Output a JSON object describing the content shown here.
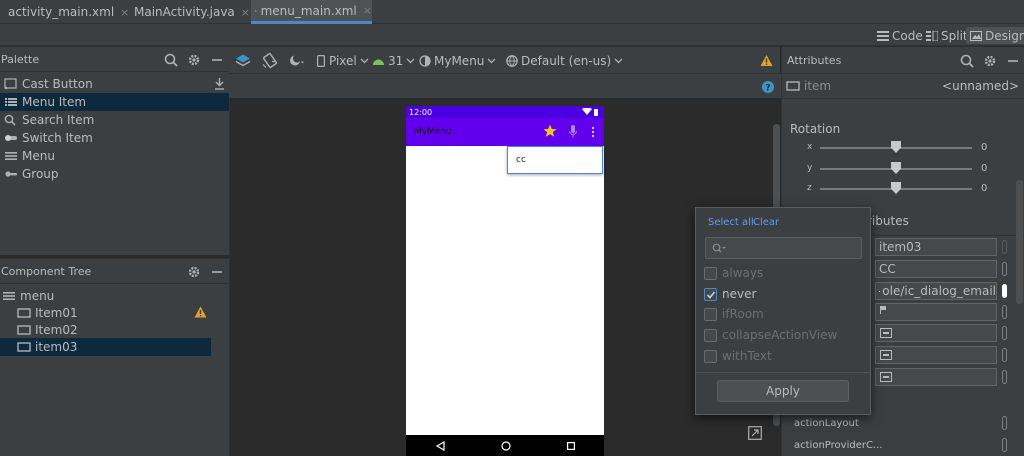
{
  "tabs": [
    {
      "label": "activity_main.xml",
      "close": "×"
    },
    {
      "label": "MainActivity.java",
      "close": "×"
    },
    {
      "label": "menu_main.xml",
      "close": "×"
    }
  ],
  "modes": {
    "code": "Code",
    "split": "Split",
    "design": "Design"
  },
  "palette": {
    "title": "Palette",
    "items": [
      "Cast Button",
      "Menu Item",
      "Search Item",
      "Switch Item",
      "Menu",
      "Group"
    ]
  },
  "component_tree": {
    "title": "Component Tree",
    "root": "menu",
    "items": [
      "Item01",
      "Item02",
      "item03"
    ]
  },
  "design_toolbar": {
    "device": "Pixel",
    "api": "31",
    "theme": "MyMenu",
    "locale": "Default (en-us)"
  },
  "phone": {
    "time": "12:00",
    "app_title": "MyMenu",
    "overflow_item": "cc"
  },
  "attributes": {
    "title": "Attributes",
    "item_label": "item",
    "item_value": "<unnamed>",
    "rotation": "Rotation",
    "axes": [
      {
        "label": "x",
        "value": "0",
        "fraction": 0.5
      },
      {
        "label": "y",
        "value": "0",
        "fraction": 0.5
      },
      {
        "label": "z",
        "value": "0",
        "fraction": 0.5
      }
    ],
    "section_suffix": "ributes",
    "id_value": "item03",
    "title_value": "CC",
    "icon_value": "ole/ic_dialog_email",
    "action_layout": "actionLayout",
    "action_provider": "actionProviderC..."
  },
  "popup": {
    "select_all": "Select all",
    "clear": "Clear",
    "search_placeholder": "",
    "options": [
      {
        "label": "always",
        "checked": false,
        "enabled": false
      },
      {
        "label": "never",
        "checked": true,
        "enabled": true
      },
      {
        "label": "ifRoom",
        "checked": false,
        "enabled": false
      },
      {
        "label": "collapseActionView",
        "checked": false,
        "enabled": false
      },
      {
        "label": "withText",
        "checked": false,
        "enabled": false
      }
    ],
    "apply": "Apply"
  },
  "colors": {
    "app_bar": "#6200ee",
    "status_bar": "#4a00e0",
    "accent": "#4a88c7",
    "warning": "#e2a32b",
    "star": "#f5c518"
  }
}
